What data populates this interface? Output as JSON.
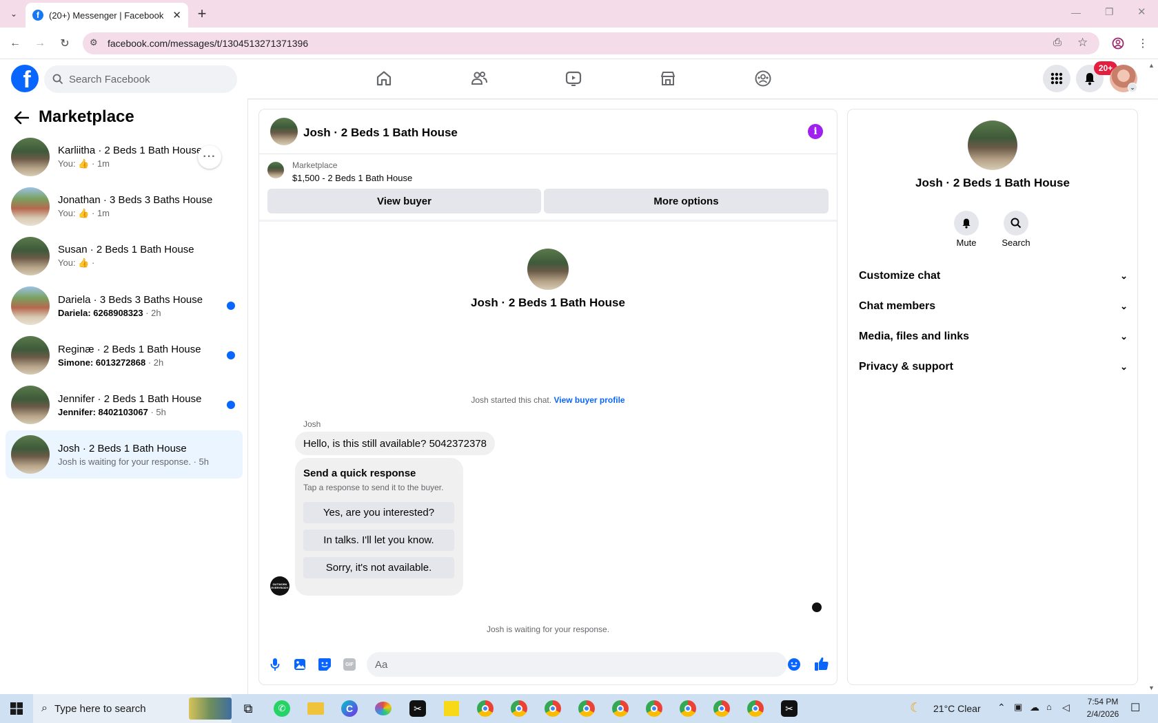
{
  "browser": {
    "tab_title": "(20+) Messenger | Facebook",
    "url": "facebook.com/messages/t/1304513271371396"
  },
  "header": {
    "search_placeholder": "Search Facebook",
    "notification_badge": "20+"
  },
  "sidebar": {
    "title": "Marketplace",
    "conversations": [
      {
        "name": "Karliitha · 2 Beds 1 Bath House",
        "you": "You:",
        "time": "· 1m",
        "unread": false
      },
      {
        "name": "Jonathan · 3 Beds 3 Baths House",
        "you": "You:",
        "time": "· 1m",
        "unread": false
      },
      {
        "name": "Susan · 2 Beds 1 Bath House",
        "you": "You:",
        "time": "·",
        "unread": false
      },
      {
        "name": "Dariela · 3 Beds 3 Baths House",
        "preview": "Dariela: 6268908323",
        "time": "· 2h",
        "unread": true
      },
      {
        "name": "Reginæ · 2 Beds 1 Bath House",
        "preview": "Simone: 6013272868",
        "time": "· 2h",
        "unread": true
      },
      {
        "name": "Jennifer · 2 Beds 1 Bath House",
        "preview": "Jennifer: 8402103067",
        "time": "· 5h",
        "unread": true
      },
      {
        "name": "Josh · 2 Beds 1 Bath House",
        "preview": "Josh is waiting for your response.",
        "time": "· 5h",
        "unread": false
      }
    ]
  },
  "chat": {
    "title": "Josh · 2 Beds 1 Bath House",
    "listing_label": "Marketplace",
    "listing_title": "$1,500 - 2 Beds 1 Bath House",
    "view_buyer": "View buyer",
    "more_options": "More options",
    "profile_name": "Josh · 2 Beds 1 Bath House",
    "started_text": "Josh started this chat.",
    "view_buyer_profile": "View buyer profile",
    "sender": "Josh",
    "message": "Hello, is this still available? 5042372378",
    "quick_title": "Send a quick response",
    "quick_sub": "Tap a response to send it to the buyer.",
    "quick_responses": [
      "Yes, are you interested?",
      "In talks. I'll let you know.",
      "Sorry, it's not available."
    ],
    "waiting": "Josh is waiting for your response.",
    "composer_placeholder": "Aa",
    "avatar_text": "OUTWORK EVERYBODY"
  },
  "details": {
    "name": "Josh · 2 Beds 1 Bath House",
    "mute": "Mute",
    "search": "Search",
    "sections": [
      "Customize chat",
      "Chat members",
      "Media, files and links",
      "Privacy & support"
    ]
  },
  "taskbar": {
    "search_placeholder": "Type here to search",
    "weather": "21°C  Clear",
    "time": "7:54 PM",
    "date": "2/4/2026"
  }
}
